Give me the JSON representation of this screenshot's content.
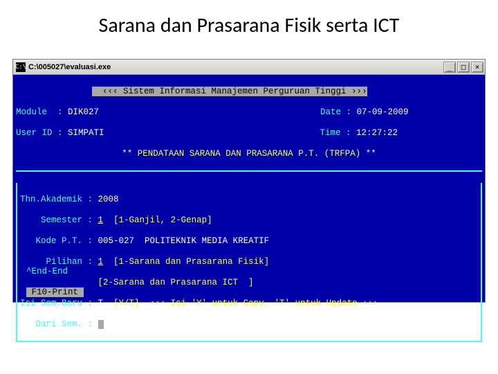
{
  "slide": {
    "title": "Sarana dan Prasarana Fisik serta ICT"
  },
  "window": {
    "icon_label": "C:\\",
    "path": "C:\\005027\\evaluasi.exe",
    "btn_min": "_",
    "btn_max": "□",
    "btn_close": "×"
  },
  "banner": "  ‹‹‹ Sistem Informasi Manajemen Perguruan Tinggi ›››",
  "header": {
    "module_label": "Module  : ",
    "module_value": "DIK027",
    "date_label": "Date : ",
    "date_value": "07-09-2009",
    "user_label": "User ID : ",
    "user_value": "SIMPATI",
    "time_label": "Time : ",
    "time_value": "12:27:22",
    "subtitle": "** PENDATAAN SARANA DAN PRASARANA P.T. (TRFPA) **"
  },
  "form": {
    "thn_label": "Thn.Akademik : ",
    "thn_value": "2008",
    "sem_label": "    Semester : ",
    "sem_value": "1",
    "sem_hint": "  [1-Ganjil, 2-Genap]",
    "kode_label": "   Kode P.T. : ",
    "kode_value": "005-027",
    "kode_name": "  POLITEKNIK MEDIA KREATIF",
    "pilihan_label": "     Pilihan : ",
    "pilihan_value": "1",
    "pilihan_hint1": "  [1-Sarana dan Prasarana Fisik]",
    "pilihan_hint2": "               [2-Sarana dan Prasarana ICT  ]",
    "isi_label": "Isi Sem.Baru : ",
    "isi_value": "T",
    "isi_hint": "  [Y/T]  ‹‹‹ Isi 'Y' untuk Copy, 'T' untuk Update ›››",
    "dari_label": "   Dari Sem. : ",
    "dari_value": "  /"
  },
  "footer": {
    "end": "^End-End",
    "print": " F10-Print "
  }
}
